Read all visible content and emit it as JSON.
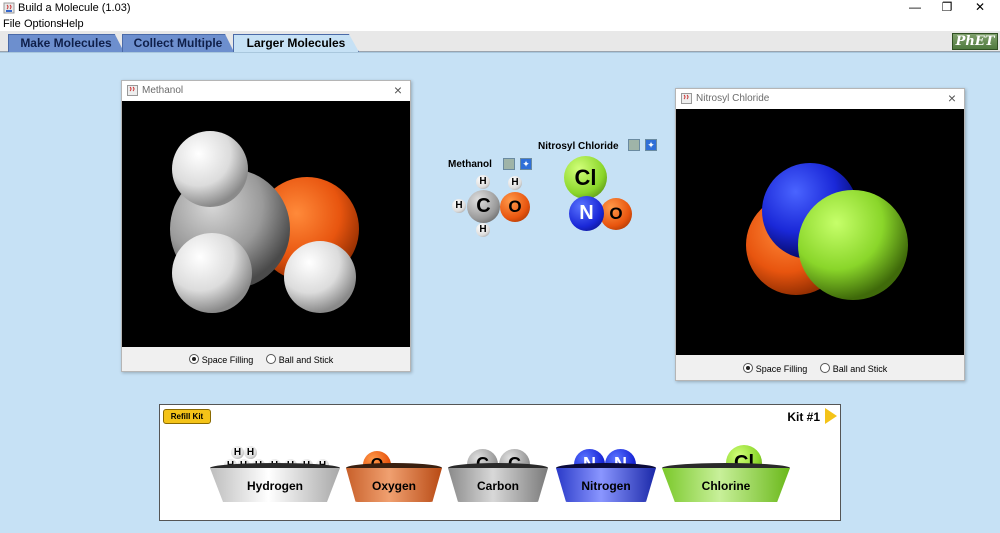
{
  "window": {
    "title": "Build a Molecule (1.03)",
    "minimize": "—",
    "restore": "❐",
    "close": "✕"
  },
  "menu": {
    "file": "File",
    "options": "Options",
    "help": "Help"
  },
  "tabs": [
    {
      "label": "Make Molecules"
    },
    {
      "label": "Collect Multiple"
    },
    {
      "label": "Larger Molecules"
    }
  ],
  "logo": "PhET",
  "viewers": {
    "methanol": {
      "title": "Methanol",
      "radio_space": "Space Filling",
      "radio_ball": "Ball and Stick",
      "selected": "Space Filling"
    },
    "nitrosyl": {
      "title": "Nitrosyl Chloride",
      "radio_space": "Space Filling",
      "radio_ball": "Ball and Stick",
      "selected": "Space Filling"
    }
  },
  "collection": {
    "methanol": {
      "label": "Methanol",
      "atoms": {
        "h1": "H",
        "h2": "H",
        "h3": "H",
        "h4": "H",
        "c": "C",
        "o": "O"
      }
    },
    "nitrosyl": {
      "label": "Nitrosyl Chloride",
      "atoms": {
        "cl": "Cl",
        "n": "N",
        "o": "O"
      }
    }
  },
  "kit": {
    "refill_label": "Refill Kit",
    "title": "Kit #1",
    "buckets": {
      "hydrogen": {
        "label": "Hydrogen",
        "atom": "H"
      },
      "oxygen": {
        "label": "Oxygen",
        "atom": "O"
      },
      "carbon": {
        "label": "Carbon",
        "atom": "C"
      },
      "nitrogen": {
        "label": "Nitrogen",
        "atom": "N"
      },
      "chlorine": {
        "label": "Chlorine",
        "atom": "Cl"
      }
    }
  },
  "colors": {
    "hydrogen": "#ffffff",
    "oxygen": "#e8550f",
    "carbon": "#9a9a9a",
    "nitrogen": "#1a28d8",
    "chlorine": "#8ad62a",
    "background": "#c6e1f5"
  }
}
